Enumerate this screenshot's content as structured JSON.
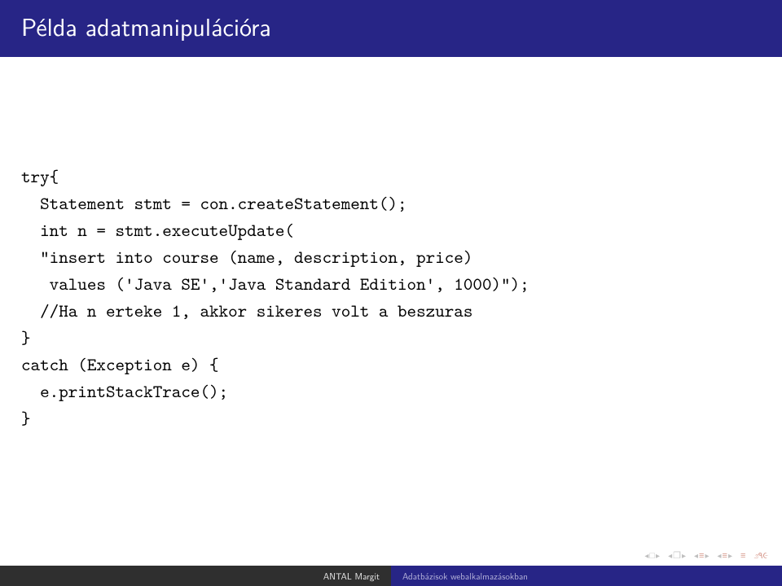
{
  "title": "Példa adatmanipulációra",
  "code": {
    "l1": "try{",
    "l2": "  Statement stmt = con.createStatement();",
    "l3": "  int n = stmt.executeUpdate(",
    "l4": "  \"insert into course (name, description, price)",
    "l5": "   values ('Java SE','Java Standard Edition', 1000)\");",
    "l6": "  //Ha n erteke 1, akkor sikeres volt a beszuras",
    "l7": "}",
    "l8": "catch (Exception e) {",
    "l9": "  e.printStackTrace();",
    "l10": "}"
  },
  "footer": {
    "author": "ANTAL Margit",
    "title": "Adatbázisok webalkalmazásokban"
  },
  "nav": {
    "l1": "◂",
    "l2": "▸",
    "box": "□",
    "doc": "❐",
    "tri": "≡",
    "refresh": "↻",
    "eps": "೨۹૯"
  }
}
